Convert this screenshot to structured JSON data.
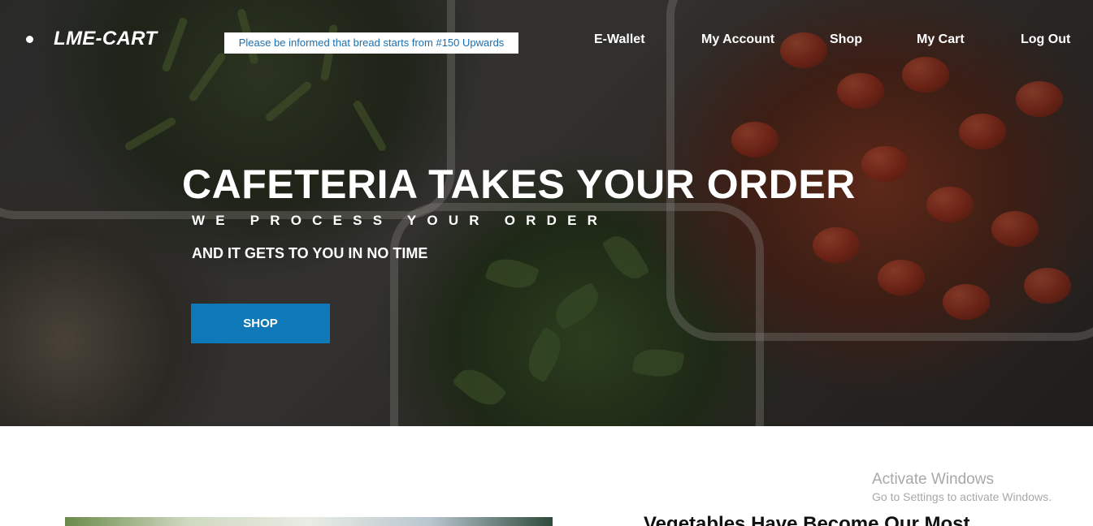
{
  "brand": {
    "name": "LME-CART"
  },
  "notice": {
    "text": "Please be informed that bread starts from #150 Upwards"
  },
  "nav": {
    "links": [
      {
        "label": "E-Wallet"
      },
      {
        "label": "My Account"
      },
      {
        "label": "Shop"
      },
      {
        "label": "My Cart"
      },
      {
        "label": "Log Out"
      }
    ]
  },
  "hero": {
    "title": "CAFETERIA TAKES YOUR ORDER",
    "subtitle": "WE PROCESS YOUR ORDER",
    "tagline": "AND IT GETS TO YOU IN NO TIME",
    "button_label": "SHOP"
  },
  "content": {
    "section_heading": "Vegetables Have Become Our Most"
  },
  "watermark": {
    "line1": "Activate Windows",
    "line2": "Go to Settings to activate Windows."
  },
  "colors": {
    "accent": "#0f78b8",
    "notice_text": "#1a6fb0"
  }
}
